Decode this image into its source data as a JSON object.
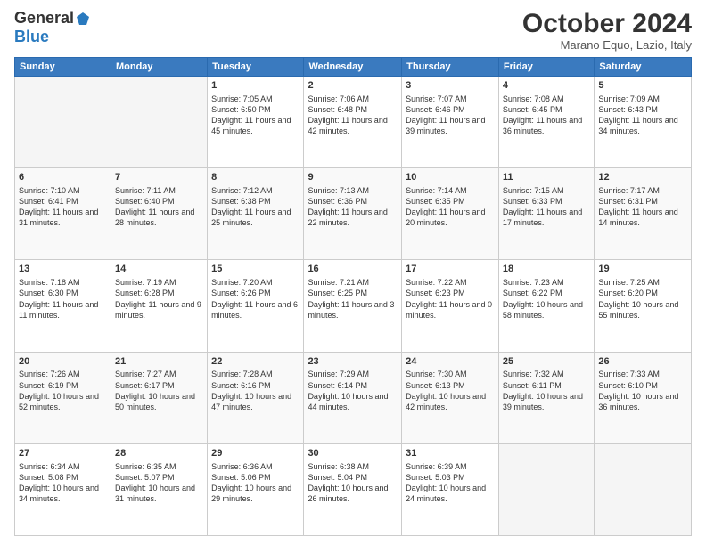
{
  "header": {
    "logo_general": "General",
    "logo_blue": "Blue",
    "month_title": "October 2024",
    "location": "Marano Equo, Lazio, Italy"
  },
  "days_of_week": [
    "Sunday",
    "Monday",
    "Tuesday",
    "Wednesday",
    "Thursday",
    "Friday",
    "Saturday"
  ],
  "weeks": [
    [
      {
        "day": "",
        "sunrise": "",
        "sunset": "",
        "daylight": "",
        "empty": true
      },
      {
        "day": "",
        "sunrise": "",
        "sunset": "",
        "daylight": "",
        "empty": true
      },
      {
        "day": "1",
        "sunrise": "Sunrise: 7:05 AM",
        "sunset": "Sunset: 6:50 PM",
        "daylight": "Daylight: 11 hours and 45 minutes."
      },
      {
        "day": "2",
        "sunrise": "Sunrise: 7:06 AM",
        "sunset": "Sunset: 6:48 PM",
        "daylight": "Daylight: 11 hours and 42 minutes."
      },
      {
        "day": "3",
        "sunrise": "Sunrise: 7:07 AM",
        "sunset": "Sunset: 6:46 PM",
        "daylight": "Daylight: 11 hours and 39 minutes."
      },
      {
        "day": "4",
        "sunrise": "Sunrise: 7:08 AM",
        "sunset": "Sunset: 6:45 PM",
        "daylight": "Daylight: 11 hours and 36 minutes."
      },
      {
        "day": "5",
        "sunrise": "Sunrise: 7:09 AM",
        "sunset": "Sunset: 6:43 PM",
        "daylight": "Daylight: 11 hours and 34 minutes."
      }
    ],
    [
      {
        "day": "6",
        "sunrise": "Sunrise: 7:10 AM",
        "sunset": "Sunset: 6:41 PM",
        "daylight": "Daylight: 11 hours and 31 minutes."
      },
      {
        "day": "7",
        "sunrise": "Sunrise: 7:11 AM",
        "sunset": "Sunset: 6:40 PM",
        "daylight": "Daylight: 11 hours and 28 minutes."
      },
      {
        "day": "8",
        "sunrise": "Sunrise: 7:12 AM",
        "sunset": "Sunset: 6:38 PM",
        "daylight": "Daylight: 11 hours and 25 minutes."
      },
      {
        "day": "9",
        "sunrise": "Sunrise: 7:13 AM",
        "sunset": "Sunset: 6:36 PM",
        "daylight": "Daylight: 11 hours and 22 minutes."
      },
      {
        "day": "10",
        "sunrise": "Sunrise: 7:14 AM",
        "sunset": "Sunset: 6:35 PM",
        "daylight": "Daylight: 11 hours and 20 minutes."
      },
      {
        "day": "11",
        "sunrise": "Sunrise: 7:15 AM",
        "sunset": "Sunset: 6:33 PM",
        "daylight": "Daylight: 11 hours and 17 minutes."
      },
      {
        "day": "12",
        "sunrise": "Sunrise: 7:17 AM",
        "sunset": "Sunset: 6:31 PM",
        "daylight": "Daylight: 11 hours and 14 minutes."
      }
    ],
    [
      {
        "day": "13",
        "sunrise": "Sunrise: 7:18 AM",
        "sunset": "Sunset: 6:30 PM",
        "daylight": "Daylight: 11 hours and 11 minutes."
      },
      {
        "day": "14",
        "sunrise": "Sunrise: 7:19 AM",
        "sunset": "Sunset: 6:28 PM",
        "daylight": "Daylight: 11 hours and 9 minutes."
      },
      {
        "day": "15",
        "sunrise": "Sunrise: 7:20 AM",
        "sunset": "Sunset: 6:26 PM",
        "daylight": "Daylight: 11 hours and 6 minutes."
      },
      {
        "day": "16",
        "sunrise": "Sunrise: 7:21 AM",
        "sunset": "Sunset: 6:25 PM",
        "daylight": "Daylight: 11 hours and 3 minutes."
      },
      {
        "day": "17",
        "sunrise": "Sunrise: 7:22 AM",
        "sunset": "Sunset: 6:23 PM",
        "daylight": "Daylight: 11 hours and 0 minutes."
      },
      {
        "day": "18",
        "sunrise": "Sunrise: 7:23 AM",
        "sunset": "Sunset: 6:22 PM",
        "daylight": "Daylight: 10 hours and 58 minutes."
      },
      {
        "day": "19",
        "sunrise": "Sunrise: 7:25 AM",
        "sunset": "Sunset: 6:20 PM",
        "daylight": "Daylight: 10 hours and 55 minutes."
      }
    ],
    [
      {
        "day": "20",
        "sunrise": "Sunrise: 7:26 AM",
        "sunset": "Sunset: 6:19 PM",
        "daylight": "Daylight: 10 hours and 52 minutes."
      },
      {
        "day": "21",
        "sunrise": "Sunrise: 7:27 AM",
        "sunset": "Sunset: 6:17 PM",
        "daylight": "Daylight: 10 hours and 50 minutes."
      },
      {
        "day": "22",
        "sunrise": "Sunrise: 7:28 AM",
        "sunset": "Sunset: 6:16 PM",
        "daylight": "Daylight: 10 hours and 47 minutes."
      },
      {
        "day": "23",
        "sunrise": "Sunrise: 7:29 AM",
        "sunset": "Sunset: 6:14 PM",
        "daylight": "Daylight: 10 hours and 44 minutes."
      },
      {
        "day": "24",
        "sunrise": "Sunrise: 7:30 AM",
        "sunset": "Sunset: 6:13 PM",
        "daylight": "Daylight: 10 hours and 42 minutes."
      },
      {
        "day": "25",
        "sunrise": "Sunrise: 7:32 AM",
        "sunset": "Sunset: 6:11 PM",
        "daylight": "Daylight: 10 hours and 39 minutes."
      },
      {
        "day": "26",
        "sunrise": "Sunrise: 7:33 AM",
        "sunset": "Sunset: 6:10 PM",
        "daylight": "Daylight: 10 hours and 36 minutes."
      }
    ],
    [
      {
        "day": "27",
        "sunrise": "Sunrise: 6:34 AM",
        "sunset": "Sunset: 5:08 PM",
        "daylight": "Daylight: 10 hours and 34 minutes."
      },
      {
        "day": "28",
        "sunrise": "Sunrise: 6:35 AM",
        "sunset": "Sunset: 5:07 PM",
        "daylight": "Daylight: 10 hours and 31 minutes."
      },
      {
        "day": "29",
        "sunrise": "Sunrise: 6:36 AM",
        "sunset": "Sunset: 5:06 PM",
        "daylight": "Daylight: 10 hours and 29 minutes."
      },
      {
        "day": "30",
        "sunrise": "Sunrise: 6:38 AM",
        "sunset": "Sunset: 5:04 PM",
        "daylight": "Daylight: 10 hours and 26 minutes."
      },
      {
        "day": "31",
        "sunrise": "Sunrise: 6:39 AM",
        "sunset": "Sunset: 5:03 PM",
        "daylight": "Daylight: 10 hours and 24 minutes."
      },
      {
        "day": "",
        "sunrise": "",
        "sunset": "",
        "daylight": "",
        "empty": true
      },
      {
        "day": "",
        "sunrise": "",
        "sunset": "",
        "daylight": "",
        "empty": true
      }
    ]
  ]
}
